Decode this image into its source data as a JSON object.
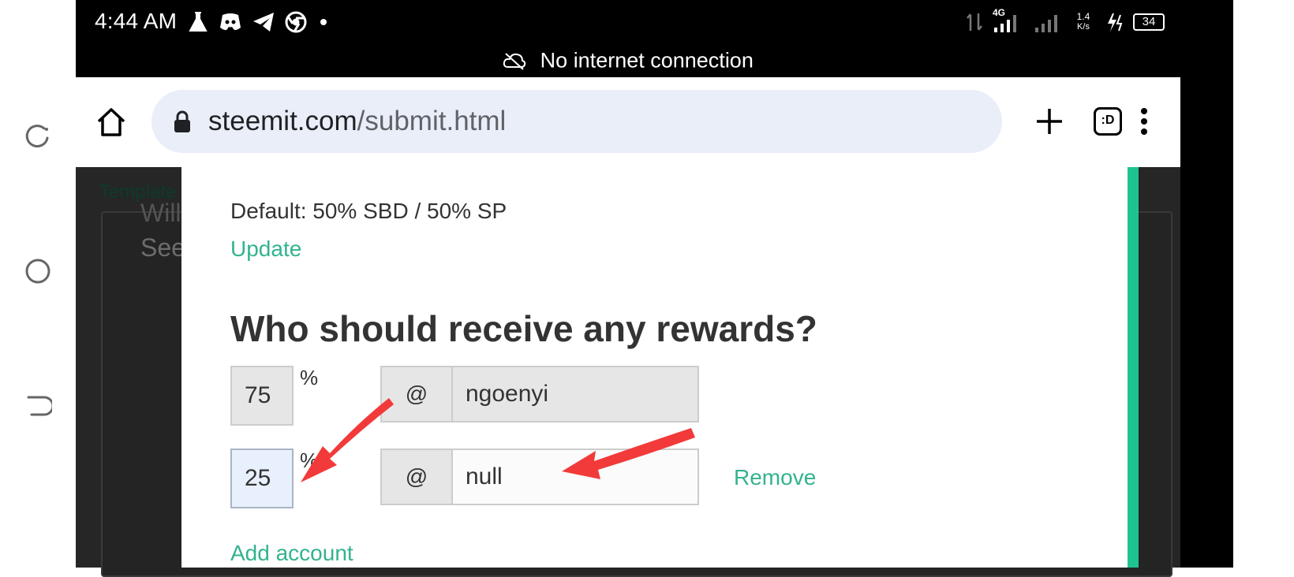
{
  "status_bar": {
    "time": "4:44 AM",
    "app_icons": [
      "flask-icon",
      "discord-icon",
      "telegram-icon",
      "chrome-icon",
      "dot-icon"
    ],
    "network_type": "4G",
    "speed_value": "1.4",
    "speed_unit": "K/s",
    "battery": "34"
  },
  "network_banner": {
    "text": "No internet connection",
    "icon": "cloud-off-icon"
  },
  "browser": {
    "url_host": "steemit.com",
    "url_path": "/submit.html",
    "tab_count_label": ":D"
  },
  "background_page": {
    "template_label": "Template",
    "text_line1": "Will g",
    "text_line2": "See w"
  },
  "modal": {
    "default_text": "Default: 50% SBD / 50% SP",
    "update_label": "Update",
    "heading": "Who should receive any rewards?",
    "percent_sign": "%",
    "at_sign": "@",
    "beneficiaries": [
      {
        "percent": "75",
        "username": "ngoenyi"
      },
      {
        "percent": "25",
        "username": "null",
        "remove_label": "Remove"
      }
    ],
    "add_account_label": "Add account"
  },
  "colors": {
    "link": "#33b38f",
    "accent_edge": "#1fc391",
    "annotation_arrow": "#f23a3a"
  }
}
